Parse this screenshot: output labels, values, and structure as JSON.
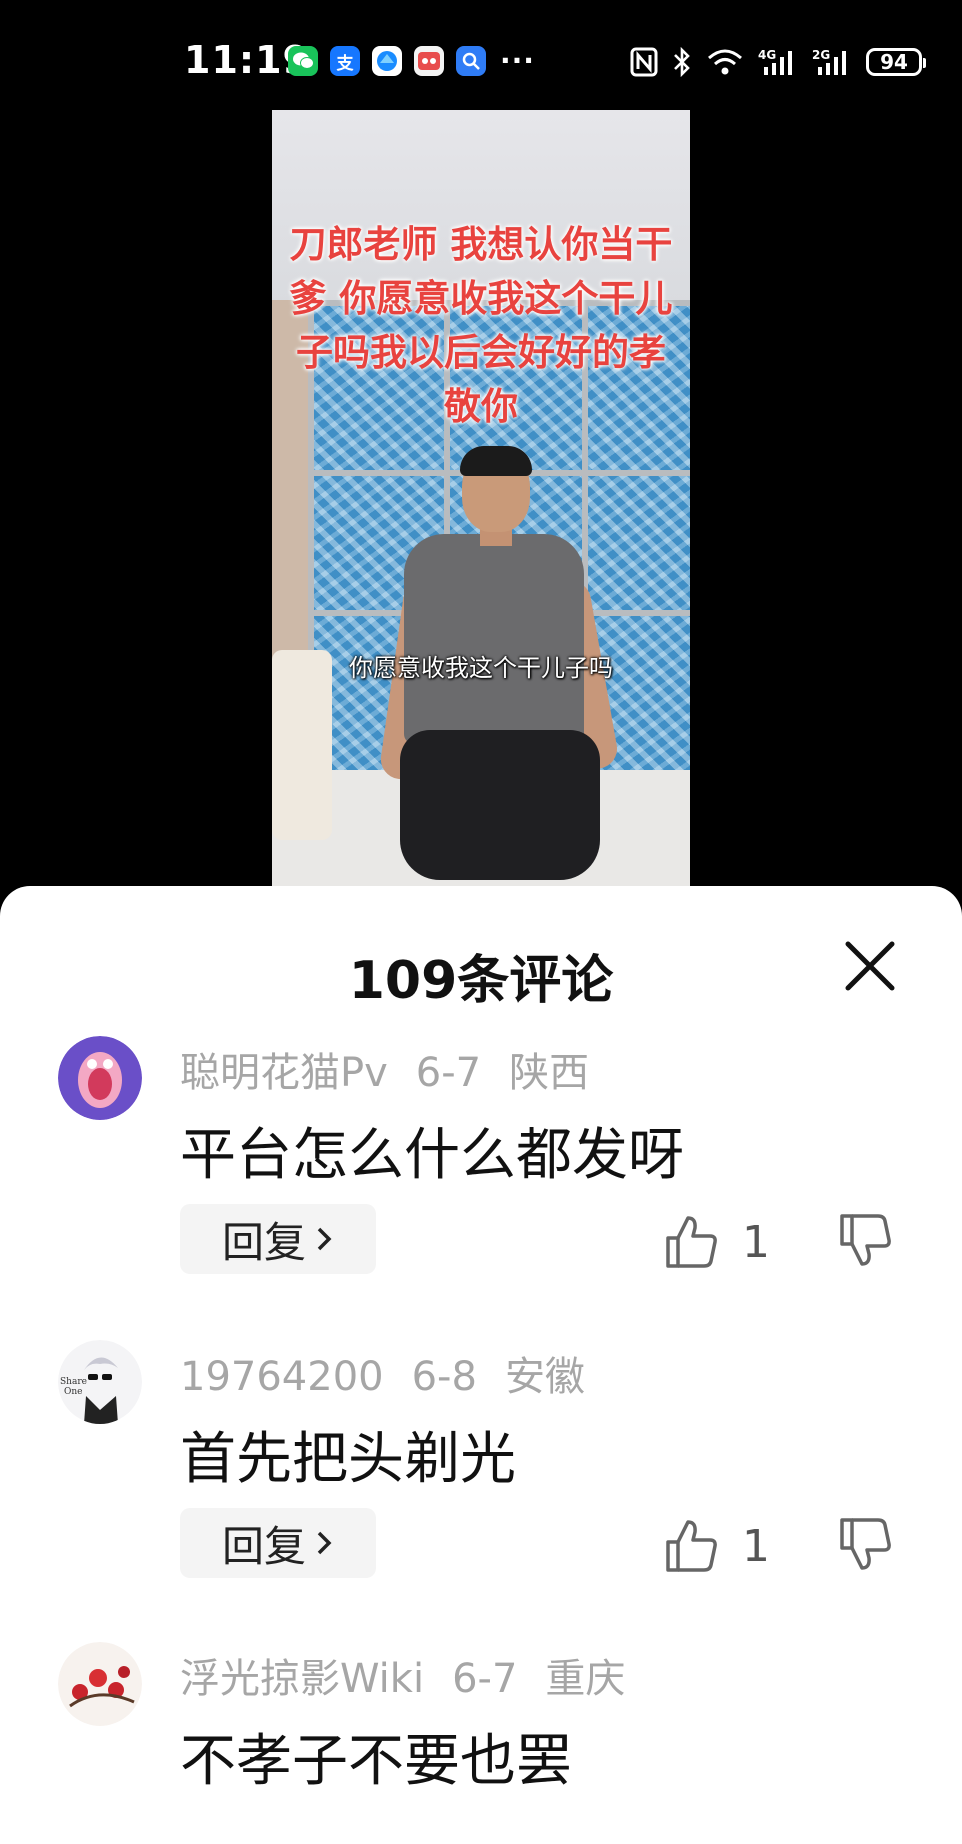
{
  "status_bar": {
    "time": "11:19",
    "app_icons": [
      "wechat-icon",
      "alipay-icon",
      "browser-icon",
      "game-icon",
      "search-icon"
    ],
    "more": "···",
    "indicators": [
      "nfc-icon",
      "bluetooth-icon",
      "wifi-icon",
      "signal-4g-icon",
      "signal-2g-icon"
    ],
    "signal_4g_label": "4G",
    "signal_2g_label": "2G",
    "battery": "94"
  },
  "video": {
    "overlay_text": "刀郎老师 我想认你当干爹 你愿意收我这个干儿子吗我以后会好好的孝敬你",
    "subtitle": "你愿意收我这个干儿子吗"
  },
  "comments_panel": {
    "title": "109条评论",
    "reply_label": "回复",
    "comments": [
      {
        "user": "聪明花猫Pv",
        "date": "6-7",
        "location": "陕西",
        "text": "平台怎么什么都发呀",
        "likes": "1"
      },
      {
        "user": "19764200",
        "date": "6-8",
        "location": "安徽",
        "text": "首先把头剃光",
        "likes": "1"
      },
      {
        "user": "浮光掠影Wiki",
        "date": "6-7",
        "location": "重庆",
        "text": "不孝子不要也罢"
      }
    ]
  },
  "colors": {
    "overlay_red": "#e8433f",
    "meta_gray": "#a6a6a6",
    "reply_bg": "#f4f4f4"
  }
}
